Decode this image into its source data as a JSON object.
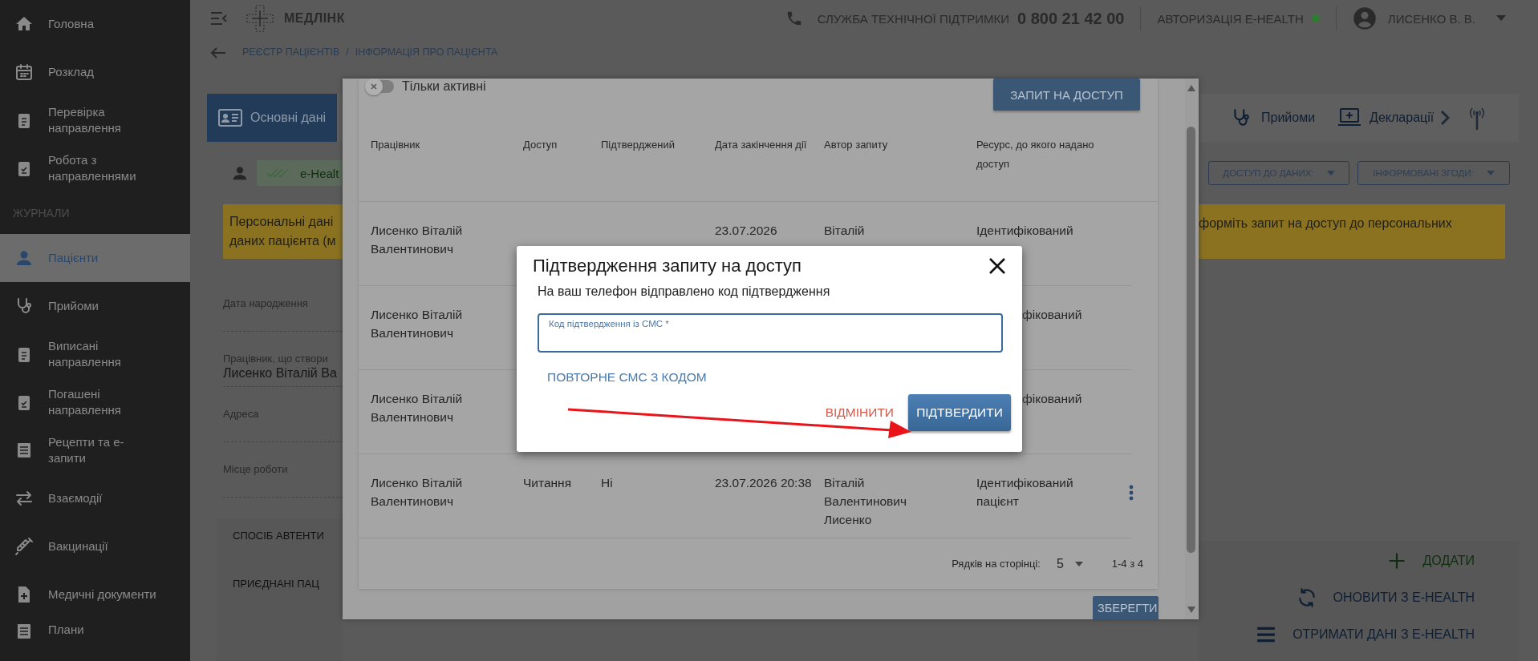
{
  "sidebar": {
    "items": [
      {
        "label": "Головна",
        "selected": false
      },
      {
        "label": "Розклад",
        "selected": false
      },
      {
        "label": "Перевірка направлення",
        "selected": false
      },
      {
        "label": "Робота з направленнями",
        "selected": false
      }
    ],
    "section": {
      "title": "ЖУРНАЛИ",
      "items": [
        {
          "label": "Пацієнти",
          "selected": true
        },
        {
          "label": "Прийоми",
          "selected": false
        },
        {
          "label": "Виписані направлення",
          "selected": false
        },
        {
          "label": "Погашені направлення",
          "selected": false
        },
        {
          "label": "Рецепти та е-запити",
          "selected": false
        },
        {
          "label": "Взаємодії",
          "selected": false
        },
        {
          "label": "Вакцинації",
          "selected": false
        },
        {
          "label": "Медичні документи",
          "selected": false
        },
        {
          "label": "Плани",
          "selected": false
        }
      ]
    }
  },
  "header": {
    "logo": "МЕДЛІНК",
    "support_label": "СЛУЖБА ТЕХНІЧНОЇ ПІДТРИМКИ",
    "support_phone": "0 800 21 42 00",
    "ehealth_label": "АВТОРИЗАЦІЯ E-HEALTH",
    "ehealth_connected": true,
    "user": "ЛИСЕНКО В. В."
  },
  "breadcrumb": {
    "items": [
      "РЕЄСТР ПАЦІЄНТІВ",
      "ІНФОРМАЦІЯ ПРО ПАЦІЄНТА"
    ],
    "separator": "/"
  },
  "patient_tabs": [
    {
      "label": "Основні дані",
      "selected": true
    },
    {
      "label": "Прийоми",
      "selected": false
    },
    {
      "label": "Декларації",
      "selected": false
    }
  ],
  "status_chip": "e-Healt",
  "dropdowns": [
    "ДОСТУП ДО ДАНИХ:",
    "ІНФОРМОВАНІ ЗГОДИ:"
  ],
  "banner": {
    "left_lines": [
      "Персональні дані",
      "даних пацієнта (м"
    ],
    "right_text": "формiть запит на доступ до персональних"
  },
  "fields": [
    {
      "label": "Дата народження"
    },
    {
      "label": "Працівник, що створи",
      "value": "Лисенко Віталій Ва"
    },
    {
      "label": "Адреса"
    },
    {
      "label": "Місце роботи"
    }
  ],
  "sections": [
    "СПОСІБ АВТЕНТИ",
    "ПРИЄДНАНІ ПАЦ"
  ],
  "actions": [
    "ДОДАТИ",
    "ОНОВИТИ З E-HEALTH",
    "ОТРИМАТИ ДАНІ З E-HEALTH"
  ],
  "access_modal": {
    "filter": {
      "label": "Тільки активні",
      "on": false
    },
    "request_button": "ЗАПИТ НА ДОСТУП",
    "columns": [
      "Працівник",
      "Доступ",
      "Підтверджений",
      "Дата закінчення дії",
      "Автор запиту",
      "Ресурс, до якого надано доступ"
    ],
    "rows": [
      {
        "employee": "Лисенко Віталій Валентинович",
        "date": "23.07.2026",
        "author": "Віталій",
        "resource": "Ідентифікований",
        "resource_covered": false,
        "menu": false
      },
      {
        "employee": "Лисенко Віталій Валентинович",
        "resource": "фікований",
        "resource_covered": true,
        "menu": false
      },
      {
        "employee": "Лисенко Віталій Валентинович",
        "resource": "фікований",
        "resource_covered": true,
        "menu": false
      },
      {
        "employee": "Лисенко Віталій Валентинович",
        "access": "Читання",
        "confirmed": "Ні",
        "date": "23.07.2026 20:38",
        "author": "Віталій Валентинович Лисенко",
        "resource": "Ідентифікований пацієнт",
        "resource_covered": false,
        "menu": true
      }
    ],
    "pagination": {
      "rows_label": "Рядків на сторінці:",
      "page_size": "5",
      "range": "1-4 з 4"
    },
    "save_button": "ЗБЕРЕГТИ"
  },
  "dialog": {
    "title": "Підтвердження запиту на доступ",
    "message": "На ваш телефон відправлено код підтвердження",
    "code_field": {
      "label": "Код підтвердження із СМС *"
    },
    "resend_button": "ПОВТОРНЕ СМС З КОДОМ",
    "cancel_button": "ВІДМІНИТИ",
    "confirm_button": "ПІДТВЕРДИТИ"
  }
}
